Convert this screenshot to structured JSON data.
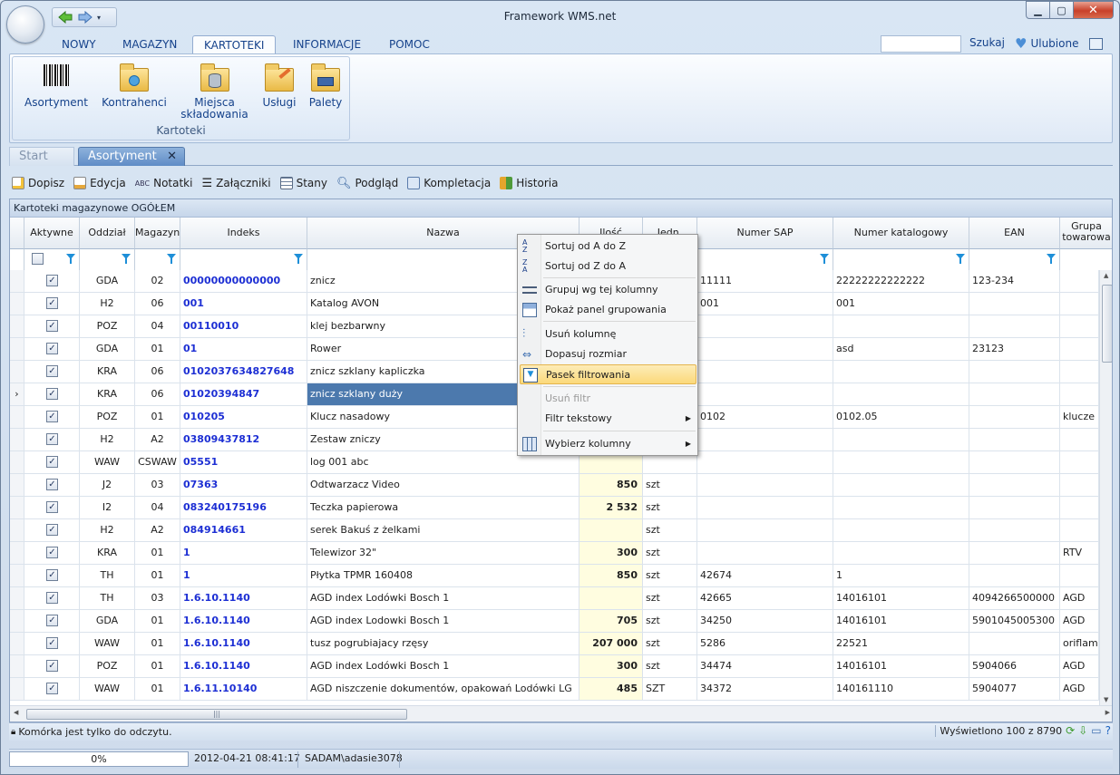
{
  "window": {
    "title": "Framework WMS.net"
  },
  "menu": {
    "tabs": [
      {
        "label": "NOWY"
      },
      {
        "label": "MAGAZYN"
      },
      {
        "label": "KARTOTEKI"
      },
      {
        "label": "INFORMACJE"
      },
      {
        "label": "POMOC"
      }
    ],
    "active": "KARTOTEKI",
    "search_label": "Szukaj",
    "favorites_label": "Ulubione"
  },
  "ribbon": {
    "group_label": "Kartoteki",
    "buttons": [
      {
        "label": "Asortyment"
      },
      {
        "label": "Kontrahenci"
      },
      {
        "label_line1": "Miejsca",
        "label_line2": "składowania"
      },
      {
        "label": "Usługi"
      },
      {
        "label": "Palety"
      }
    ]
  },
  "doc_tabs": [
    {
      "label": "Start"
    },
    {
      "label": "Asortyment"
    }
  ],
  "toolbar": [
    "Dopisz",
    "Edycja",
    "Notatki",
    "Załączniki",
    "Stany",
    "Podgląd",
    "Kompletacja",
    "Historia"
  ],
  "grid": {
    "caption": "Kartoteki magazynowe OGÓŁEM",
    "columns": [
      "Aktywne",
      "Oddział",
      "Magazyn",
      "Indeks",
      "Nazwa",
      "Ilość",
      "Jedn.",
      "Numer SAP",
      "Numer katalogowy",
      "EAN",
      "Grupa towarowa"
    ],
    "rows": [
      {
        "active": true,
        "branch": "GDA",
        "store": "02",
        "index": "00000000000000",
        "name": "znicz",
        "qty": "",
        "unit": "",
        "sap": "11111",
        "cat": "22222222222222",
        "ean": "123-234",
        "group": ""
      },
      {
        "active": true,
        "branch": "H2",
        "store": "06",
        "index": "001",
        "name": "Katalog AVON",
        "qty": "",
        "unit": "",
        "sap": "001",
        "cat": "001",
        "ean": "",
        "group": ""
      },
      {
        "active": true,
        "branch": "POZ",
        "store": "04",
        "index": "00110010",
        "name": "klej bezbarwny",
        "qty": "",
        "unit": "",
        "sap": "",
        "cat": "",
        "ean": "",
        "group": ""
      },
      {
        "active": true,
        "branch": "GDA",
        "store": "01",
        "index": "01",
        "name": "Rower",
        "qty": "",
        "unit": "",
        "sap": "",
        "cat": "asd",
        "ean": "23123",
        "group": ""
      },
      {
        "active": true,
        "branch": "KRA",
        "store": "06",
        "index": "0102037634827648",
        "name": "znicz szklany kapliczka",
        "qty": "",
        "unit": "",
        "sap": "",
        "cat": "",
        "ean": "",
        "group": ""
      },
      {
        "active": true,
        "branch": "KRA",
        "store": "06",
        "index": "01020394847",
        "name": "znicz szklany duży",
        "qty": "",
        "unit": "",
        "sap": "",
        "cat": "",
        "ean": "",
        "group": "",
        "selected": true
      },
      {
        "active": true,
        "branch": "POZ",
        "store": "01",
        "index": "010205",
        "name": "Klucz nasadowy",
        "qty": "",
        "unit": "",
        "sap": "0102",
        "cat": "0102.05",
        "ean": "",
        "group": "klucze"
      },
      {
        "active": true,
        "branch": "H2",
        "store": "A2",
        "index": "03809437812",
        "name": "Zestaw zniczy",
        "qty": "",
        "unit": "",
        "sap": "",
        "cat": "",
        "ean": "",
        "group": ""
      },
      {
        "active": true,
        "branch": "WAW",
        "store": "CSWAW",
        "index": "05551",
        "name": "log 001 abc",
        "qty": "",
        "unit": "",
        "sap": "",
        "cat": "",
        "ean": "",
        "group": ""
      },
      {
        "active": true,
        "branch": "J2",
        "store": "03",
        "index": "07363",
        "name": "Odtwarzacz Video",
        "qty": "850",
        "unit": "szt",
        "sap": "",
        "cat": "",
        "ean": "",
        "group": ""
      },
      {
        "active": true,
        "branch": "I2",
        "store": "04",
        "index": "083240175196",
        "name": "Teczka papierowa",
        "qty": "2 532",
        "unit": "szt",
        "sap": "",
        "cat": "",
        "ean": "",
        "group": ""
      },
      {
        "active": true,
        "branch": "H2",
        "store": "A2",
        "index": "084914661",
        "name": "serek Bakuś z żelkami",
        "qty": "",
        "unit": "szt",
        "sap": "",
        "cat": "",
        "ean": "",
        "group": ""
      },
      {
        "active": true,
        "branch": "KRA",
        "store": "01",
        "index": "1",
        "name": "Telewizor 32\"",
        "qty": "300",
        "unit": "szt",
        "sap": "",
        "cat": "",
        "ean": "",
        "group": "RTV"
      },
      {
        "active": true,
        "branch": "TH",
        "store": "01",
        "index": "1",
        "name": "Płytka TPMR 160408",
        "qty": "850",
        "unit": "szt",
        "sap": "42674",
        "cat": "1",
        "ean": "",
        "group": ""
      },
      {
        "active": true,
        "branch": "TH",
        "store": "03",
        "index": "1.6.10.1140",
        "name": "AGD index Lodówki Bosch 1",
        "qty": "",
        "unit": "szt",
        "sap": "42665",
        "cat": "14016101",
        "ean": "4094266500000",
        "group": "AGD"
      },
      {
        "active": true,
        "branch": "GDA",
        "store": "01",
        "index": "1.6.10.1140",
        "name": "AGD index Lodowki Bosch 1",
        "qty": "705",
        "unit": "szt",
        "sap": "34250",
        "cat": "14016101",
        "ean": "5901045005300",
        "group": "AGD"
      },
      {
        "active": true,
        "branch": "WAW",
        "store": "01",
        "index": "1.6.10.1140",
        "name": "tusz pogrubiajacy rzęsy",
        "qty": "207 000",
        "unit": "szt",
        "sap": "5286",
        "cat": "22521",
        "ean": "",
        "group": "oriflam"
      },
      {
        "active": true,
        "branch": "POZ",
        "store": "01",
        "index": "1.6.10.1140",
        "name": "AGD index Lodówki Bosch 1",
        "qty": "300",
        "unit": "szt",
        "sap": "34474",
        "cat": "14016101",
        "ean": "5904066",
        "group": "AGD"
      },
      {
        "active": true,
        "branch": "WAW",
        "store": "01",
        "index": "1.6.11.10140",
        "name": "AGD niszczenie dokumentów, opakowań Lodówki LG",
        "qty": "485",
        "unit": "SZT",
        "sap": "34372",
        "cat": "140161110",
        "ean": "5904077",
        "group": "AGD"
      }
    ]
  },
  "context_menu": {
    "items": [
      {
        "label": "Sortuj od A do Z"
      },
      {
        "label": "Sortuj od Z do A"
      },
      {
        "label": "Grupuj wg tej kolumny"
      },
      {
        "label": "Pokaż panel grupowania"
      },
      {
        "label": "Usuń kolumnę"
      },
      {
        "label": "Dopasuj rozmiar"
      },
      {
        "label": "Pasek filtrowania"
      },
      {
        "label": "Usuń filtr"
      },
      {
        "label": "Filtr tekstowy"
      },
      {
        "label": "Wybierz kolumny"
      }
    ]
  },
  "status": {
    "message": "Komórka jest tylko do odczytu.",
    "count": "Wyświetlono 100 z 8790"
  },
  "bottom": {
    "progress": "0%",
    "datetime": "2012-04-21 08:41:17",
    "user": "SADAM\\adasie3078"
  }
}
